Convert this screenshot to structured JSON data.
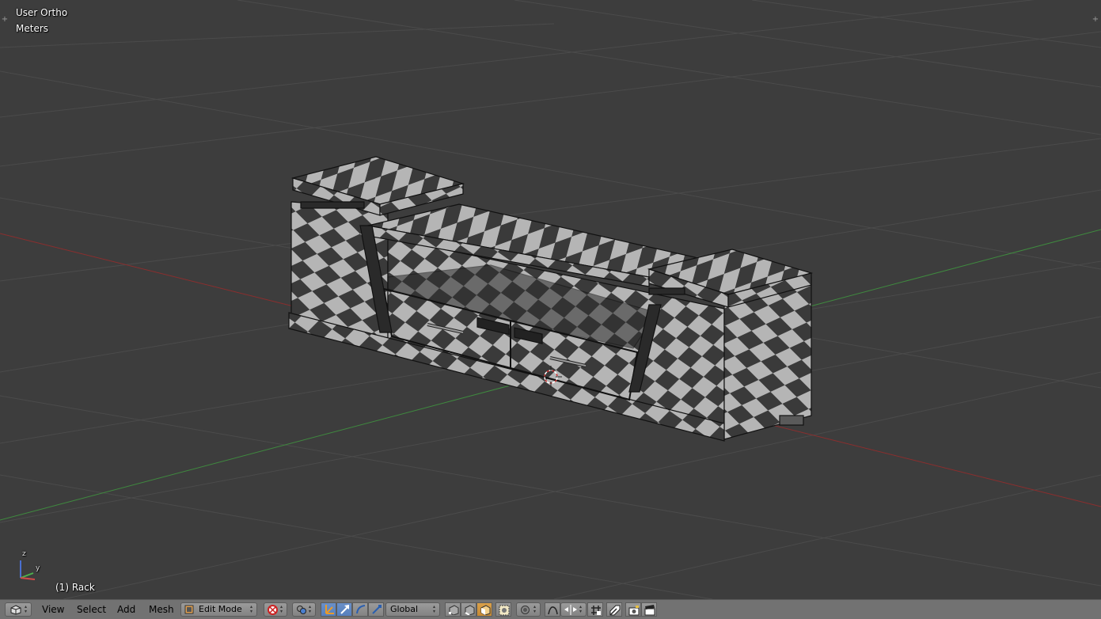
{
  "viewport": {
    "view_name": "User Ortho",
    "units": "Meters",
    "object_label": "(1) Rack",
    "axis_labels": {
      "z": "z",
      "y": "y"
    }
  },
  "header": {
    "menus": [
      "View",
      "Select",
      "Add",
      "Mesh"
    ],
    "mode": "Edit Mode",
    "orientation": "Global"
  },
  "colors": {
    "background": "#3d3d3d",
    "grid": "#4b4b4b",
    "x_axis": "#8b2e2e",
    "y_axis": "#3f8a3f",
    "header": "#727272",
    "active_button": "#5680bd",
    "checker_light": "#b5b5b5",
    "checker_dark": "#3a3a3a"
  }
}
